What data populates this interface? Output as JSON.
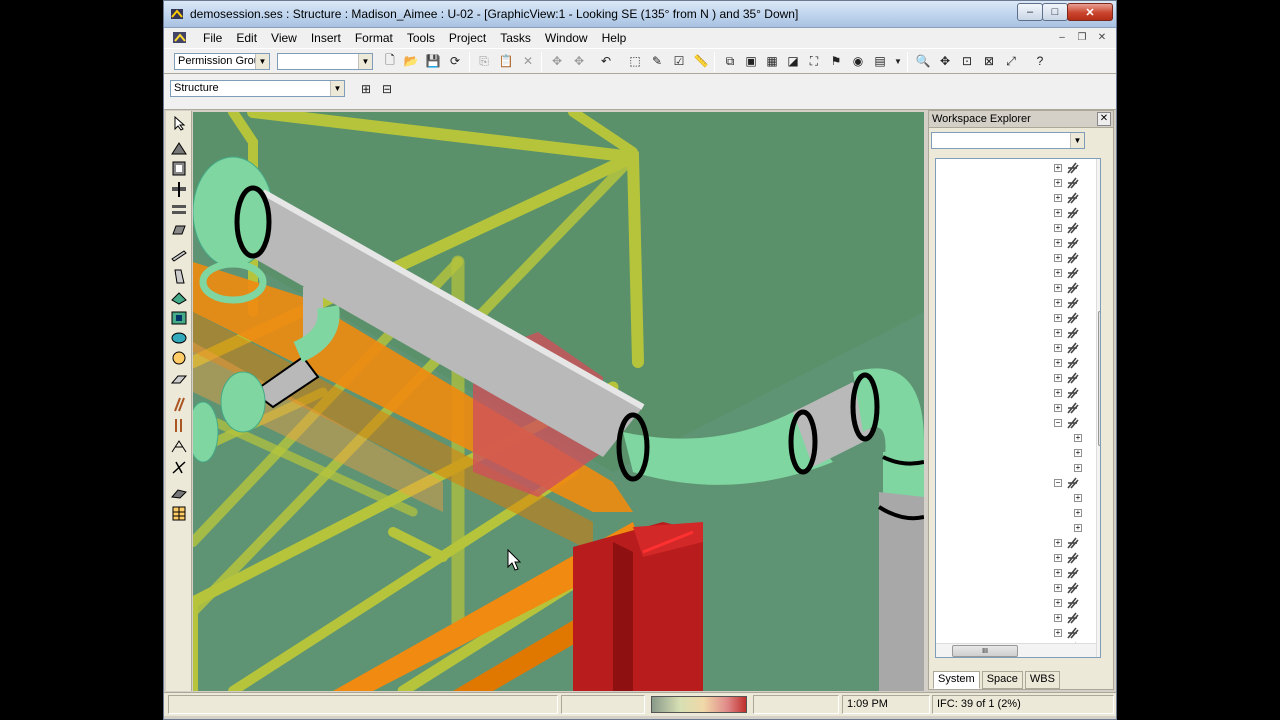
{
  "window": {
    "title": "demosession.ses : Structure : Madison_Aimee : U-02 - [GraphicView:1 - Looking SE (135° from N ) and 35° Down]",
    "caption_buttons": {
      "minimize": "–",
      "maximize": "□",
      "close": "✕"
    }
  },
  "menu": {
    "items": [
      "File",
      "Edit",
      "View",
      "Insert",
      "Format",
      "Tools",
      "Project",
      "Tasks",
      "Window",
      "Help"
    ],
    "mdi_buttons": {
      "minimize": "–",
      "restore": "❐",
      "close": "✕"
    }
  },
  "toolbar1": {
    "permission_group": "Permission Group",
    "second_combo": ""
  },
  "toolbar2": {
    "task": "Structure"
  },
  "workspace_explorer": {
    "title": "Workspace Explorer",
    "close": "✕",
    "filter": "",
    "tabs": [
      "System",
      "Space",
      "WBS"
    ],
    "active_tab": "System",
    "hscroll_grip": "III",
    "vscroll_grip": "≡"
  },
  "status": {
    "message": "",
    "time": "1:09 PM",
    "ifc": "IFC: 39 of 1 (2%)"
  },
  "colors": {
    "background": "#5a916a",
    "handrail": "#b6c43c",
    "pipe_gray": "#b9b9b9",
    "pipe_green": "#7fd6a0",
    "beam_orange": "#f08a10",
    "column_red": "#b81c1c"
  }
}
